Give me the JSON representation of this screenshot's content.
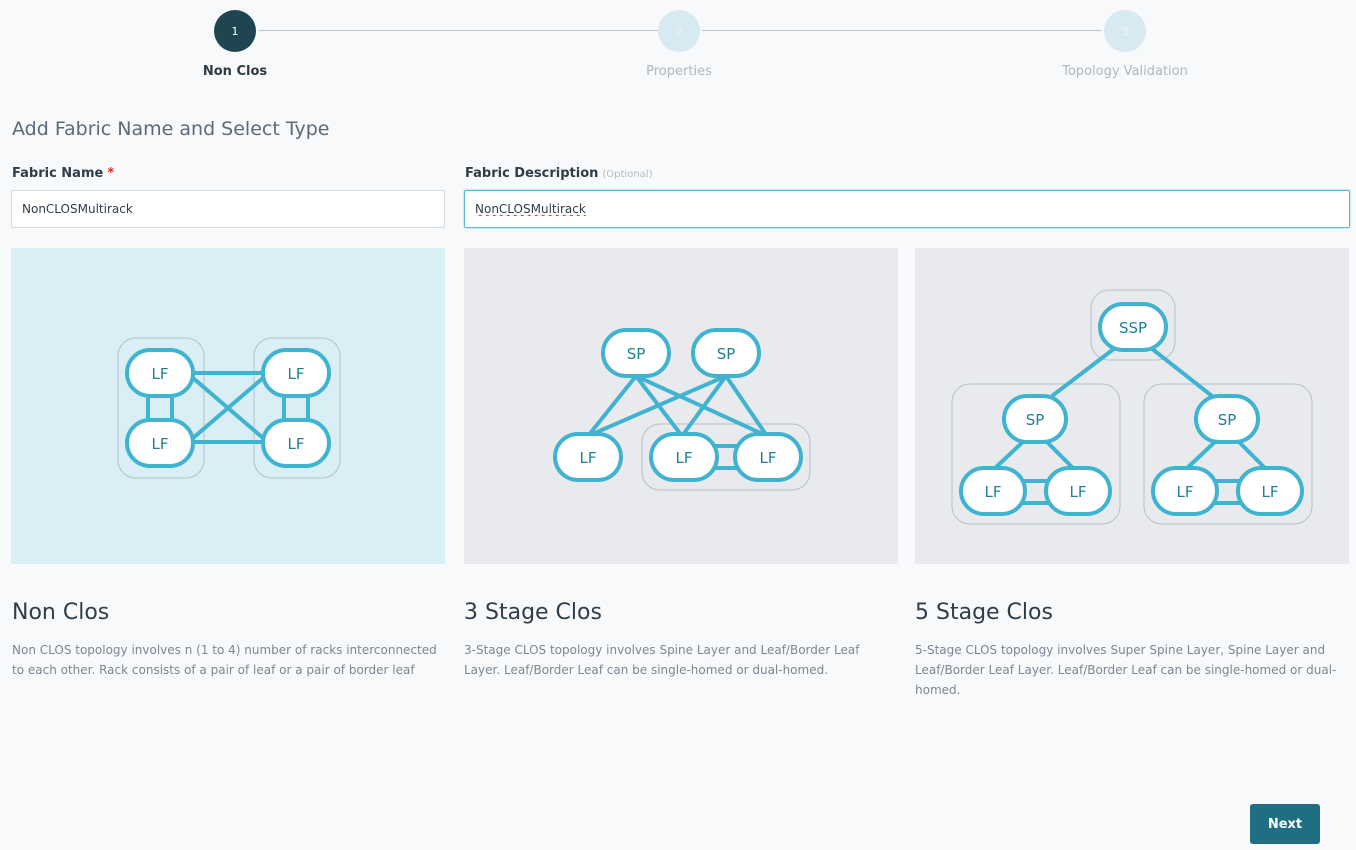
{
  "stepper": {
    "steps": [
      {
        "number": "1",
        "label": "Non Clos",
        "state": "active"
      },
      {
        "number": "2",
        "label": "Properties",
        "state": "inactive"
      },
      {
        "number": "3",
        "label": "Topology Validation",
        "state": "inactive"
      }
    ]
  },
  "form": {
    "section_title": "Add Fabric Name and Select Type",
    "fabric_name": {
      "label": "Fabric Name",
      "required_marker": "*",
      "value": "NonCLOSMultirack"
    },
    "fabric_description": {
      "label": "Fabric Description",
      "optional_hint": "(Optional)",
      "value": "NonCLOSMultirack"
    }
  },
  "cards": [
    {
      "title": "Non Clos",
      "description": "Non CLOS topology involves n (1 to 4) number of racks interconnected to each other. Rack consists of a pair of leaf or a pair of border leaf",
      "selected": true
    },
    {
      "title": "3 Stage Clos",
      "description": "3-Stage CLOS topology involves Spine Layer and Leaf/Border Leaf Layer. Leaf/Border Leaf can be single-homed or dual-homed.",
      "selected": false
    },
    {
      "title": "5 Stage Clos",
      "description": "5-Stage CLOS topology involves Super Spine Layer, Spine Layer and Leaf/Border Leaf Layer. Leaf/Border Leaf can be single-homed or dual-homed.",
      "selected": false
    }
  ],
  "diagram_labels": {
    "leaf": "LF",
    "spine": "SP",
    "super_spine": "SSP"
  },
  "actions": {
    "next_label": "Next"
  },
  "colors": {
    "accent": "#1f6f82",
    "node_stroke": "#3fb3cf",
    "selected_card": "#d9eef5"
  }
}
